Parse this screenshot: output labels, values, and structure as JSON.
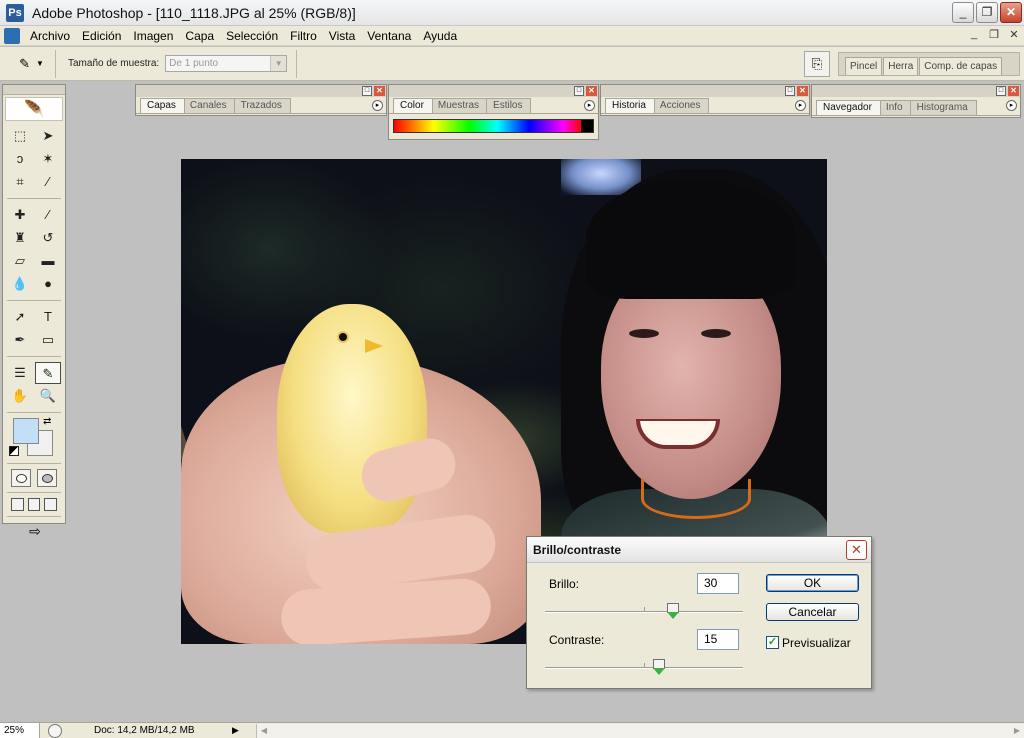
{
  "window": {
    "title": "Adobe Photoshop - [110_1118.JPG al 25% (RGB/8)]"
  },
  "menu": [
    "Archivo",
    "Edición",
    "Imagen",
    "Capa",
    "Selección",
    "Filtro",
    "Vista",
    "Ventana",
    "Ayuda"
  ],
  "options_bar": {
    "sample_label": "Tamaño de muestra:",
    "sample_value": "De 1 punto"
  },
  "palette_well": {
    "tabs": [
      "Pincel",
      "Herra",
      "Comp. de capas"
    ]
  },
  "palettes": {
    "layers": {
      "tabs": [
        "Capas",
        "Canales",
        "Trazados"
      ]
    },
    "color": {
      "tabs": [
        "Color",
        "Muestras",
        "Estilos"
      ]
    },
    "history": {
      "tabs": [
        "Historia",
        "Acciones"
      ]
    },
    "navigator": {
      "tabs": [
        "Navegador",
        "Info",
        "Histograma"
      ]
    }
  },
  "colors": {
    "foreground": "#c2dff5",
    "background": "#f0f0f0"
  },
  "dialog": {
    "title": "Brillo/contraste",
    "brightness_label": "Brillo:",
    "brightness_value": "30",
    "contrast_label": "Contraste:",
    "contrast_value": "15",
    "ok_label": "OK",
    "cancel_label": "Cancelar",
    "preview_label": "Previsualizar",
    "preview_checked": true
  },
  "status": {
    "zoom": "25%",
    "doc_info": "Doc: 14,2 MB/14,2 MB"
  }
}
